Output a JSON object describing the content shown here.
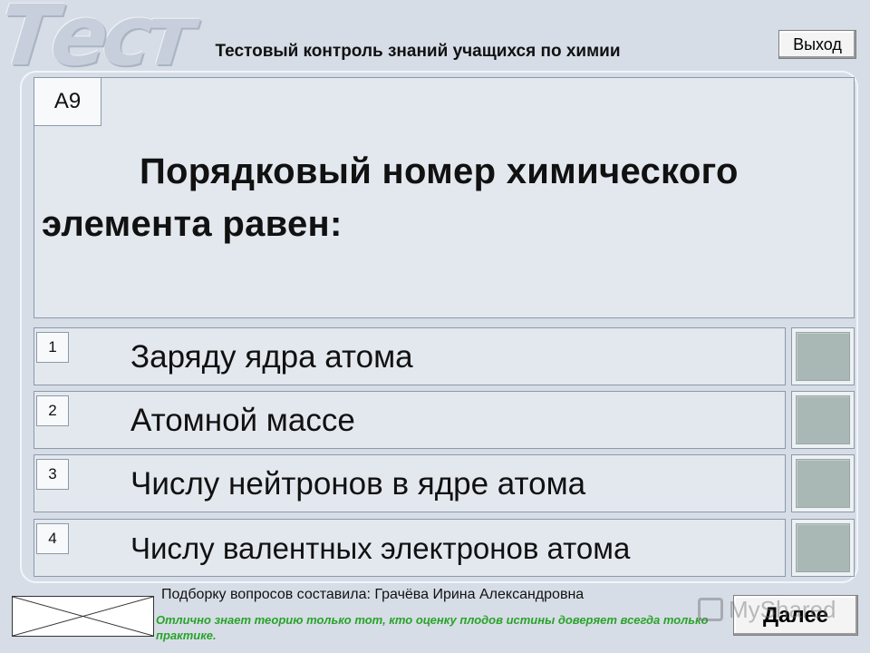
{
  "header": {
    "logo_text": "Тест",
    "title": "Тестовый контроль знаний учащихся по химии",
    "exit_label": "Выход"
  },
  "question": {
    "number": "А9",
    "text": "Порядковый номер химического элемента равен:"
  },
  "answers": [
    {
      "num": "1",
      "text": "Заряду ядра атома"
    },
    {
      "num": "2",
      "text": "Атомной массе"
    },
    {
      "num": "3",
      "text": "Числу нейтронов в ядре атома"
    },
    {
      "num": "4",
      "text": "Числу валентных электронов атома"
    }
  ],
  "footer": {
    "author": "Подборку вопросов составила: Грачёва Ирина Александровна",
    "quote": "Отлично знает теорию только тот, кто оценку плодов истины доверяет всегда только практике.",
    "next_label": "Далее",
    "watermark": "MyShared"
  },
  "colors": {
    "background": "#d6dde7",
    "panel": "#e3e8ef",
    "checkbox": "#a9b7b5",
    "quote": "#29a329"
  }
}
